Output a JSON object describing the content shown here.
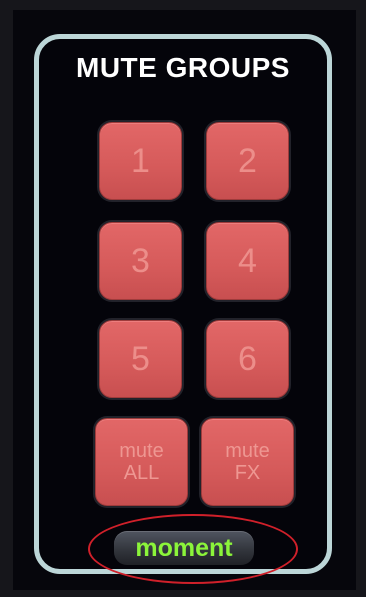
{
  "panel": {
    "title": "MUTE GROUPS"
  },
  "groups": [
    {
      "label": "1"
    },
    {
      "label": "2"
    },
    {
      "label": "3"
    },
    {
      "label": "4"
    },
    {
      "label": "5"
    },
    {
      "label": "6"
    }
  ],
  "mute_all": {
    "line1": "mute",
    "line2": "ALL"
  },
  "mute_fx": {
    "line1": "mute",
    "line2": "FX"
  },
  "moment_button": {
    "label": "moment"
  },
  "colors": {
    "button_red": "#d55a5a",
    "button_text": "#ec8e8a",
    "panel_border": "#bcd6d8",
    "moment_text": "#8bf43a",
    "highlight_ellipse": "#d0202a"
  }
}
